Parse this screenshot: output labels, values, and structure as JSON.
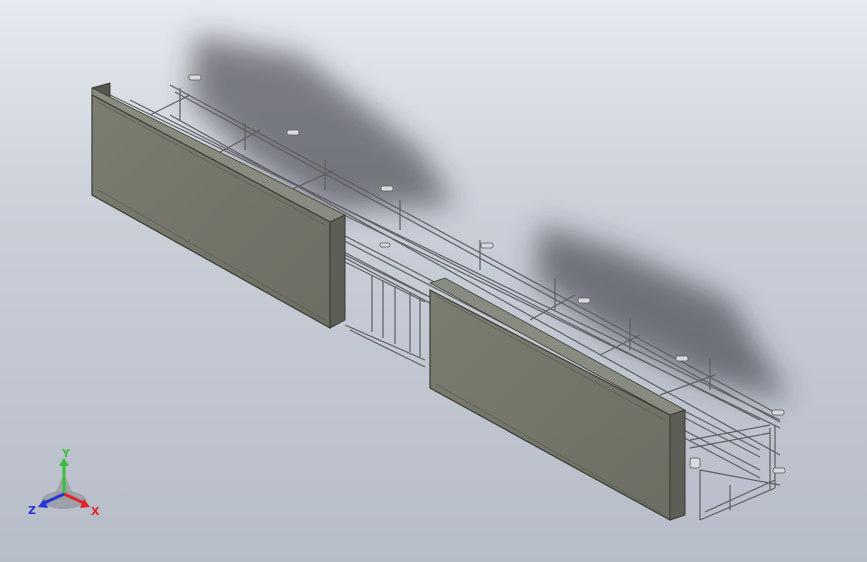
{
  "colors": {
    "panel_face": "#75766a",
    "panel_edge": "#3a3b33",
    "frame": "#6f7074",
    "shadow": "#2a2c33",
    "axis_x": "#e0242a",
    "axis_y": "#3bbf3b",
    "axis_z": "#2436d6"
  },
  "scene": {
    "model": "steel-frame-with-two-panels",
    "icons": [
      "view-triad-icon"
    ]
  },
  "triad": {
    "x_label": "X",
    "y_label": "Y",
    "z_label": "Z"
  }
}
